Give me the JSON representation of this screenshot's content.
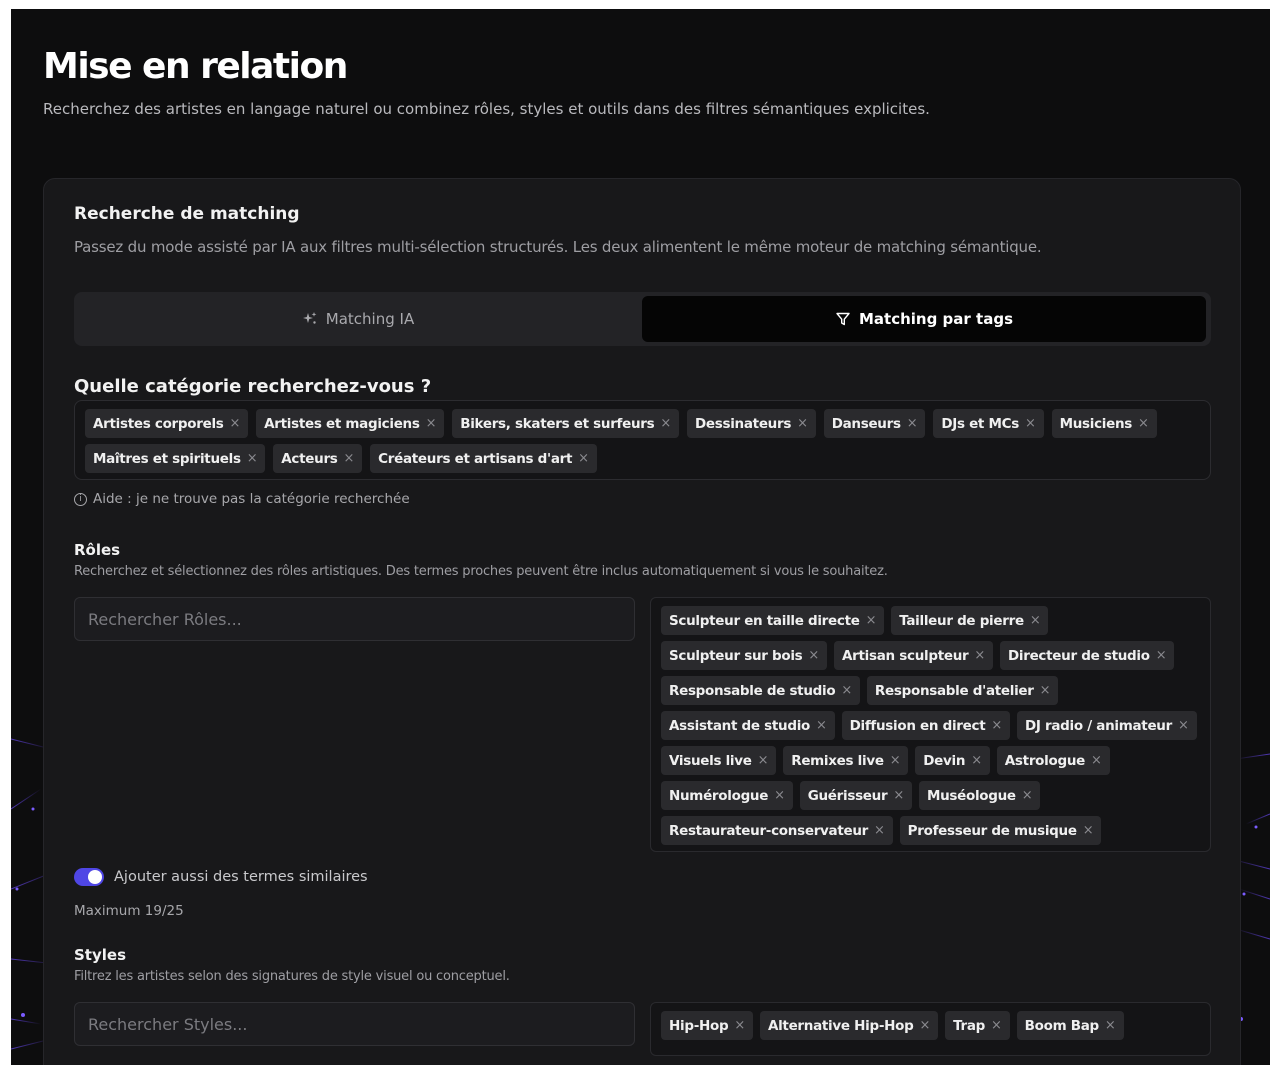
{
  "header": {
    "title": "Mise en relation",
    "subtitle": "Recherchez des artistes en langage naturel ou combinez rôles, styles et outils dans des filtres sémantiques explicites."
  },
  "card": {
    "title": "Recherche de matching",
    "description": "Passez du mode assisté par IA aux filtres multi-sélection structurés. Les deux alimentent le même moteur de matching sémantique."
  },
  "modes": {
    "ia_label": "Matching IA",
    "tags_label": "Matching par tags",
    "active": "tags"
  },
  "category": {
    "question": "Quelle catégorie recherchez-vous ?",
    "tags": [
      "Artistes corporels",
      "Artistes et magiciens",
      "Bikers, skaters et surfeurs",
      "Dessinateurs",
      "Danseurs",
      "DJs et MCs",
      "Musiciens",
      "Maîtres et spirituels",
      "Acteurs",
      "Créateurs et artisans d'art"
    ],
    "help": "Aide : je ne trouve pas la catégorie recherchée"
  },
  "roles": {
    "label": "Rôles",
    "description": "Recherchez et sélectionnez des rôles artistiques. Des termes proches peuvent être inclus automatiquement si vous le souhaitez.",
    "placeholder": "Rechercher Rôles...",
    "tags": [
      "Sculpteur en taille directe",
      "Tailleur de pierre",
      "Sculpteur sur bois",
      "Artisan sculpteur",
      "Directeur de studio",
      "Responsable de studio",
      "Responsable d'atelier",
      "Assistant de studio",
      "Diffusion en direct",
      "DJ radio / animateur",
      "Visuels live",
      "Remixes live",
      "Devin",
      "Astrologue",
      "Numérologue",
      "Guérisseur",
      "Muséologue",
      "Restaurateur-conservateur",
      "Professeur de musique"
    ],
    "similar_toggle_label": "Ajouter aussi des termes similaires",
    "similar_toggle_on": true,
    "maximum": "Maximum 19/25"
  },
  "styles": {
    "label": "Styles",
    "description": "Filtrez les artistes selon des signatures de style visuel ou conceptuel.",
    "placeholder": "Rechercher Styles...",
    "tags": [
      "Hip-Hop",
      "Alternative Hip-Hop",
      "Trap",
      "Boom Bap"
    ]
  },
  "colors": {
    "page_bg": "#0d0d0e",
    "card_bg": "#18181a",
    "tag_bg": "#2a2a2d",
    "accent": "#4f46e5",
    "decor": "#5b3fd8"
  },
  "icons": {
    "ia": "sparkle-icon",
    "tags": "filter-icon",
    "help": "info-icon",
    "tag_remove": "close-icon"
  }
}
